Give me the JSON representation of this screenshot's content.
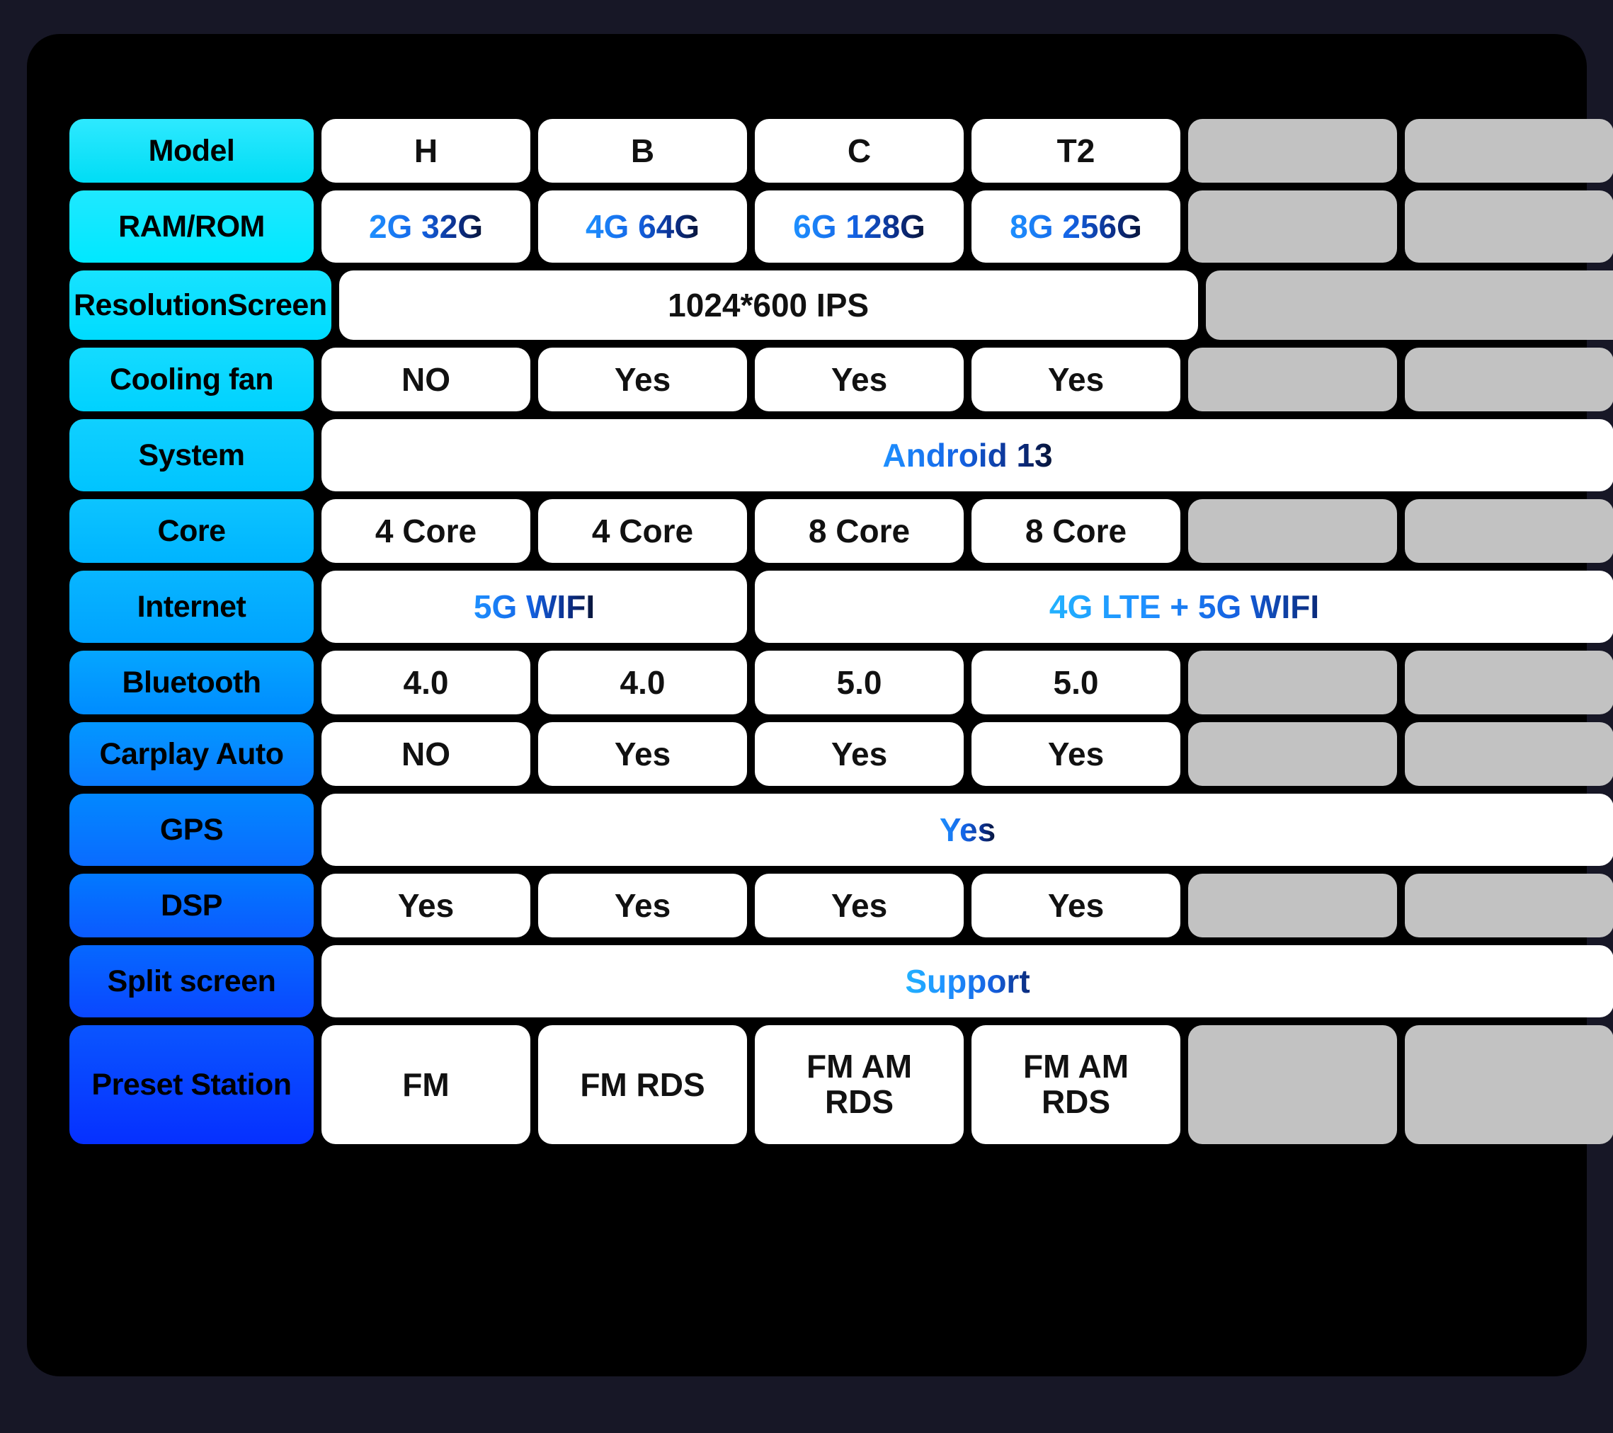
{
  "colors": {
    "panel_background": "#000000",
    "page_background": "#171726",
    "value_cell": "#ffffff",
    "empty_cell": "#c2c2c2",
    "label_start": "#2EE9FF",
    "label_end": "#0630FF",
    "accent_blue_text": "#1E90FF"
  },
  "table": {
    "columns": [
      "Model",
      "H",
      "B",
      "C",
      "T2",
      "",
      ""
    ],
    "rows": [
      {
        "label": "Model",
        "cells": [
          {
            "text": "H",
            "style": "black"
          },
          {
            "text": "B",
            "style": "black"
          },
          {
            "text": "C",
            "style": "black"
          },
          {
            "text": "T2",
            "style": "black"
          },
          {
            "text": "",
            "style": "empty"
          },
          {
            "text": "",
            "style": "empty"
          }
        ]
      },
      {
        "label": "RAM/ROM",
        "cells": [
          {
            "text": "2G 32G",
            "style": "blue"
          },
          {
            "text": "4G 64G",
            "style": "blue"
          },
          {
            "text": "6G 128G",
            "style": "blue"
          },
          {
            "text": "8G 256G",
            "style": "blue"
          },
          {
            "text": "",
            "style": "empty"
          },
          {
            "text": "",
            "style": "empty"
          }
        ]
      },
      {
        "label": "Resolution Screen",
        "label_lines": [
          "Resolution",
          "Screen"
        ],
        "cells": [
          {
            "text": "1024*600 IPS",
            "style": "black",
            "span": 4
          },
          {
            "text": "",
            "style": "empty",
            "span": 2
          }
        ]
      },
      {
        "label": "Cooling fan",
        "cells": [
          {
            "text": "NO",
            "style": "black"
          },
          {
            "text": "Yes",
            "style": "black"
          },
          {
            "text": "Yes",
            "style": "black"
          },
          {
            "text": "Yes",
            "style": "black"
          },
          {
            "text": "",
            "style": "empty"
          },
          {
            "text": "",
            "style": "empty"
          }
        ]
      },
      {
        "label": "System",
        "cells": [
          {
            "text": "Android 13",
            "style": "blue",
            "span": 6
          }
        ]
      },
      {
        "label": "Core",
        "cells": [
          {
            "text": "4 Core",
            "style": "black"
          },
          {
            "text": "4 Core",
            "style": "black"
          },
          {
            "text": "8 Core",
            "style": "black"
          },
          {
            "text": "8 Core",
            "style": "black"
          },
          {
            "text": "",
            "style": "empty"
          },
          {
            "text": "",
            "style": "empty"
          }
        ]
      },
      {
        "label": "Internet",
        "cells": [
          {
            "text": "5G WIFI",
            "style": "blue",
            "span": 2
          },
          {
            "text": "4G LTE + 5G WIFI",
            "style": "lightblue",
            "span": 4
          }
        ]
      },
      {
        "label": "Bluetooth",
        "cells": [
          {
            "text": "4.0",
            "style": "black"
          },
          {
            "text": "4.0",
            "style": "black"
          },
          {
            "text": "5.0",
            "style": "black"
          },
          {
            "text": "5.0",
            "style": "black"
          },
          {
            "text": "",
            "style": "empty"
          },
          {
            "text": "",
            "style": "empty"
          }
        ]
      },
      {
        "label": "Carplay Auto",
        "cells": [
          {
            "text": "NO",
            "style": "black"
          },
          {
            "text": "Yes",
            "style": "black"
          },
          {
            "text": "Yes",
            "style": "black"
          },
          {
            "text": "Yes",
            "style": "black"
          },
          {
            "text": "",
            "style": "empty"
          },
          {
            "text": "",
            "style": "empty"
          }
        ]
      },
      {
        "label": "GPS",
        "cells": [
          {
            "text": "Yes",
            "style": "blue",
            "span": 6
          }
        ]
      },
      {
        "label": "DSP",
        "cells": [
          {
            "text": "Yes",
            "style": "black"
          },
          {
            "text": "Yes",
            "style": "black"
          },
          {
            "text": "Yes",
            "style": "black"
          },
          {
            "text": "Yes",
            "style": "black"
          },
          {
            "text": "",
            "style": "empty"
          },
          {
            "text": "",
            "style": "empty"
          }
        ]
      },
      {
        "label": "Split screen",
        "cells": [
          {
            "text": "Support",
            "style": "lightblue",
            "span": 6
          }
        ]
      },
      {
        "label": "Preset Station",
        "cells": [
          {
            "text": "FM",
            "style": "black"
          },
          {
            "text": "FM RDS",
            "style": "black"
          },
          {
            "text": "FM AM\nRDS",
            "style": "black"
          },
          {
            "text": "FM AM\nRDS",
            "style": "black"
          },
          {
            "text": "",
            "style": "empty"
          },
          {
            "text": "",
            "style": "empty"
          }
        ]
      }
    ]
  }
}
